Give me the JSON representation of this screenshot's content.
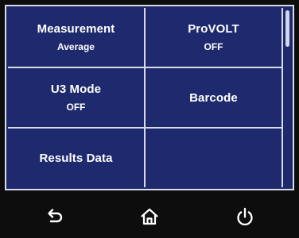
{
  "menu": {
    "cells": [
      {
        "title": "Measurement",
        "value": "Average"
      },
      {
        "title": "ProVOLT",
        "value": "OFF"
      },
      {
        "title": "U3 Mode",
        "value": "OFF"
      },
      {
        "title": "Barcode",
        "value": ""
      },
      {
        "title": "Results Data",
        "value": ""
      },
      {
        "title": "",
        "value": ""
      }
    ]
  },
  "navbar": {
    "icons": [
      "back-arrow-icon",
      "home-icon",
      "power-icon"
    ]
  },
  "colors": {
    "panel_bg": "#1f2a6e",
    "grid_lines": "#d8dbe8",
    "text": "#ffffff",
    "screen_bg": "#0d0d0d"
  }
}
